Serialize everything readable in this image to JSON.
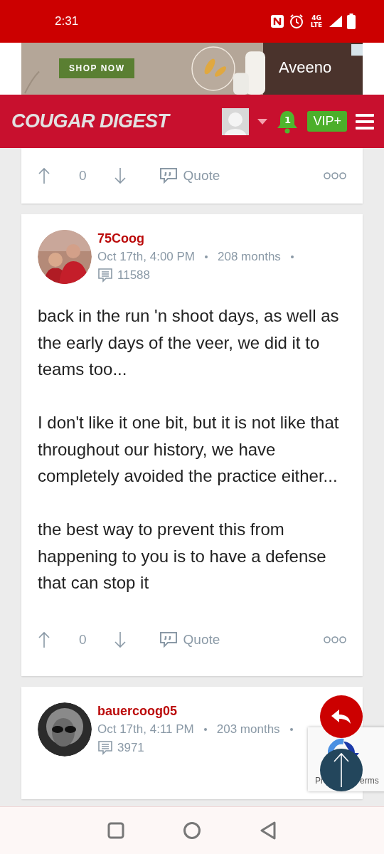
{
  "status_bar": {
    "time": "2:31",
    "network": "4G LTE"
  },
  "ad": {
    "button": "SHOP NOW",
    "brand": "Aveeno"
  },
  "header": {
    "logo": "COUGAR DIGEST",
    "notifications": "1",
    "vip": "VIP+"
  },
  "posts": [
    {
      "kind": "partial",
      "votes": "0",
      "quote": "Quote"
    },
    {
      "kind": "full",
      "author": "75Coog",
      "date": "Oct 17th, 4:00 PM",
      "tenure": "208 months",
      "post_count": "11588",
      "paragraphs": [
        "back in the run 'n shoot days, as well as the early days of the veer, we did it to teams too...",
        "I don't like it one bit, but it is not like that throughout our history, we have completely avoided the practice either...",
        "the best way to prevent this from happening to you is to have a defense that can stop it"
      ],
      "votes": "0",
      "quote": "Quote"
    },
    {
      "kind": "header",
      "author": "bauercoog05",
      "date": "Oct 17th, 4:11 PM",
      "tenure": "203 months",
      "post_count": "3971"
    }
  ],
  "recaptcha": {
    "left_text": "Pr",
    "right_text": "erms"
  }
}
